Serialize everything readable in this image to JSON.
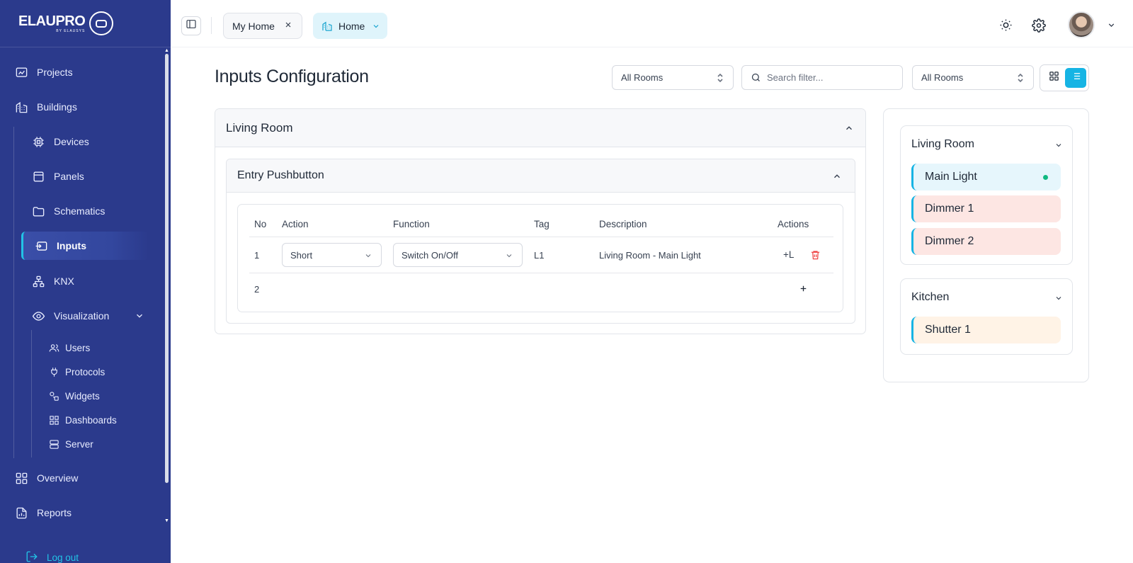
{
  "brand": {
    "name": "ELAUPRO",
    "sub": "BY ELAUSYS"
  },
  "sidebar": {
    "items": [
      {
        "label": "Projects",
        "icon": "presentation-board-icon"
      },
      {
        "label": "Buildings",
        "icon": "building-icon"
      },
      {
        "label": "Devices",
        "icon": "chip-icon"
      },
      {
        "label": "Panels",
        "icon": "panel-icon"
      },
      {
        "label": "Schematics",
        "icon": "folder-icon"
      },
      {
        "label": "Inputs",
        "icon": "input-icon"
      },
      {
        "label": "KNX",
        "icon": "network-icon"
      },
      {
        "label": "Visualization",
        "icon": "eye-icon"
      },
      {
        "label": "Overview",
        "icon": "grid-icon"
      },
      {
        "label": "Reports",
        "icon": "report-icon"
      }
    ],
    "sub_items": [
      {
        "label": "Users",
        "icon": "users-icon"
      },
      {
        "label": "Protocols",
        "icon": "plug-icon"
      },
      {
        "label": "Widgets",
        "icon": "shapes-icon"
      },
      {
        "label": "Dashboards",
        "icon": "dashboard-icon"
      },
      {
        "label": "Server",
        "icon": "server-icon"
      }
    ],
    "active": "Inputs",
    "logout_label": "Log out"
  },
  "topbar": {
    "tab_myhome": "My Home",
    "tab_home": "Home"
  },
  "page": {
    "title": "Inputs Configuration",
    "filter1": "All Rooms",
    "search_placeholder": "Search filter...",
    "filter2": "All Rooms"
  },
  "room_card": {
    "title": "Living Room",
    "device_title": "Entry Pushbutton",
    "headers": {
      "no": "No",
      "action": "Action",
      "function": "Function",
      "tag": "Tag",
      "description": "Description",
      "actions": "Actions"
    },
    "rows": [
      {
        "no": "1",
        "action": "Short",
        "function": "Switch On/Off",
        "tag": "L1",
        "description": "Living Room - Main Light",
        "add_label": "+L"
      },
      {
        "no": "2"
      }
    ]
  },
  "right_panel": {
    "groups": [
      {
        "title": "Living Room",
        "items": [
          "Main Light",
          "Dimmer 1",
          "Dimmer 2"
        ]
      },
      {
        "title": "Kitchen",
        "items": [
          "Shutter 1"
        ]
      }
    ]
  },
  "colors": {
    "sidebar_bg": "#2b3a8c",
    "accent": "#16b4e4",
    "dimmer_bg": "#fde6e3",
    "shutter_bg": "#fff3e6",
    "main_light_bg": "#e6f6fc",
    "status_dot": "#10b981",
    "danger": "#ef4444"
  }
}
